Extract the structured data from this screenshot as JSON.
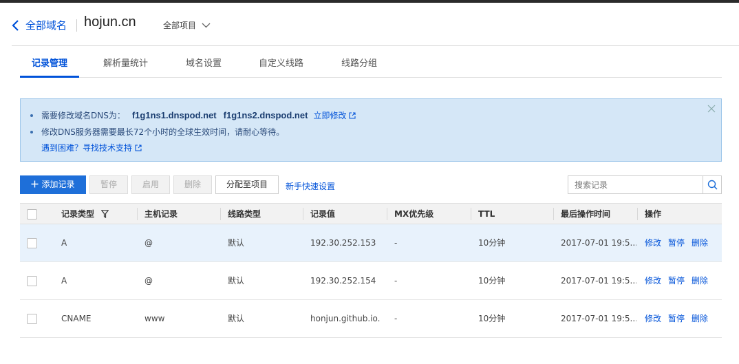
{
  "header": {
    "back_label": "全部域名",
    "domain": "hojun.cn",
    "project_select": "全部项目"
  },
  "tabs": [
    {
      "label": "记录管理",
      "active": true
    },
    {
      "label": "解析量统计",
      "active": false
    },
    {
      "label": "域名设置",
      "active": false
    },
    {
      "label": "自定义线路",
      "active": false
    },
    {
      "label": "线路分组",
      "active": false
    }
  ],
  "notice": {
    "line1_prefix": "需要修改域名DNS为：",
    "ns1": "f1g1ns1.dnspod.net",
    "ns2": "f1g1ns2.dnspod.net",
    "modify_link": "立即修改",
    "line2": "修改DNS服务器需要最长72个小时的全球生效时间，请耐心等待。",
    "help_link": "遇到困难？寻找技术支持"
  },
  "toolbar": {
    "add_label": "添加记录",
    "pause_label": "暂停",
    "enable_label": "启用",
    "delete_label": "删除",
    "assign_label": "分配至项目",
    "quick_setup_label": "新手快速设置",
    "search_placeholder": "搜索记录"
  },
  "table": {
    "headers": {
      "type": "记录类型",
      "host": "主机记录",
      "line": "线路类型",
      "value": "记录值",
      "mx": "MX优先级",
      "ttl": "TTL",
      "time": "最后操作时间",
      "ops": "操作"
    },
    "rows": [
      {
        "type": "A",
        "host": "@",
        "line": "默认",
        "value": "192.30.252.153",
        "mx": "-",
        "ttl": "10分钟",
        "time": "2017-07-01 19:5...",
        "edit": "修改",
        "pause": "暂停",
        "delete": "删除"
      },
      {
        "type": "A",
        "host": "@",
        "line": "默认",
        "value": "192.30.252.154",
        "mx": "-",
        "ttl": "10分钟",
        "time": "2017-07-01 19:5...",
        "edit": "修改",
        "pause": "暂停",
        "delete": "删除"
      },
      {
        "type": "CNAME",
        "host": "www",
        "line": "默认",
        "value": "honjun.github.io.",
        "mx": "-",
        "ttl": "10分钟",
        "time": "2017-07-01 19:5...",
        "edit": "修改",
        "pause": "暂停",
        "delete": "删除"
      }
    ]
  },
  "colors": {
    "accent": "#0052d9",
    "primary_button": "#1e6fd9",
    "notice_bg": "#d5e7f7",
    "row_hover": "#e8f2fc"
  }
}
